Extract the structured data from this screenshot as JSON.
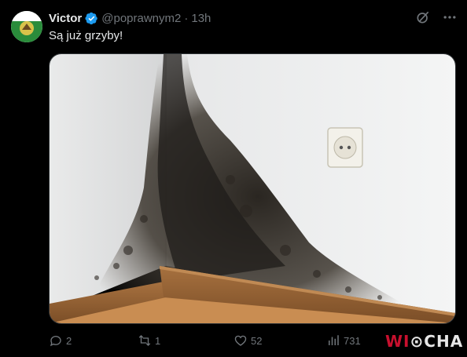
{
  "tweet": {
    "author_name": "Victor",
    "handle": "@poprawnym2",
    "separator": "·",
    "time": "13h",
    "text": "Są już grzyby!"
  },
  "stats": {
    "replies": "2",
    "reposts": "1",
    "likes": "52",
    "views": "731"
  },
  "watermark": {
    "lead": "WI",
    "trail": "CHA"
  },
  "colors": {
    "verified_badge": "#1d9bf0",
    "muted_text": "#71767b",
    "text": "#e7e9ea"
  },
  "icons": [
    "verified-badge-icon",
    "grok-icon",
    "more-options-icon",
    "reply-icon",
    "repost-icon",
    "like-icon",
    "views-icon"
  ]
}
